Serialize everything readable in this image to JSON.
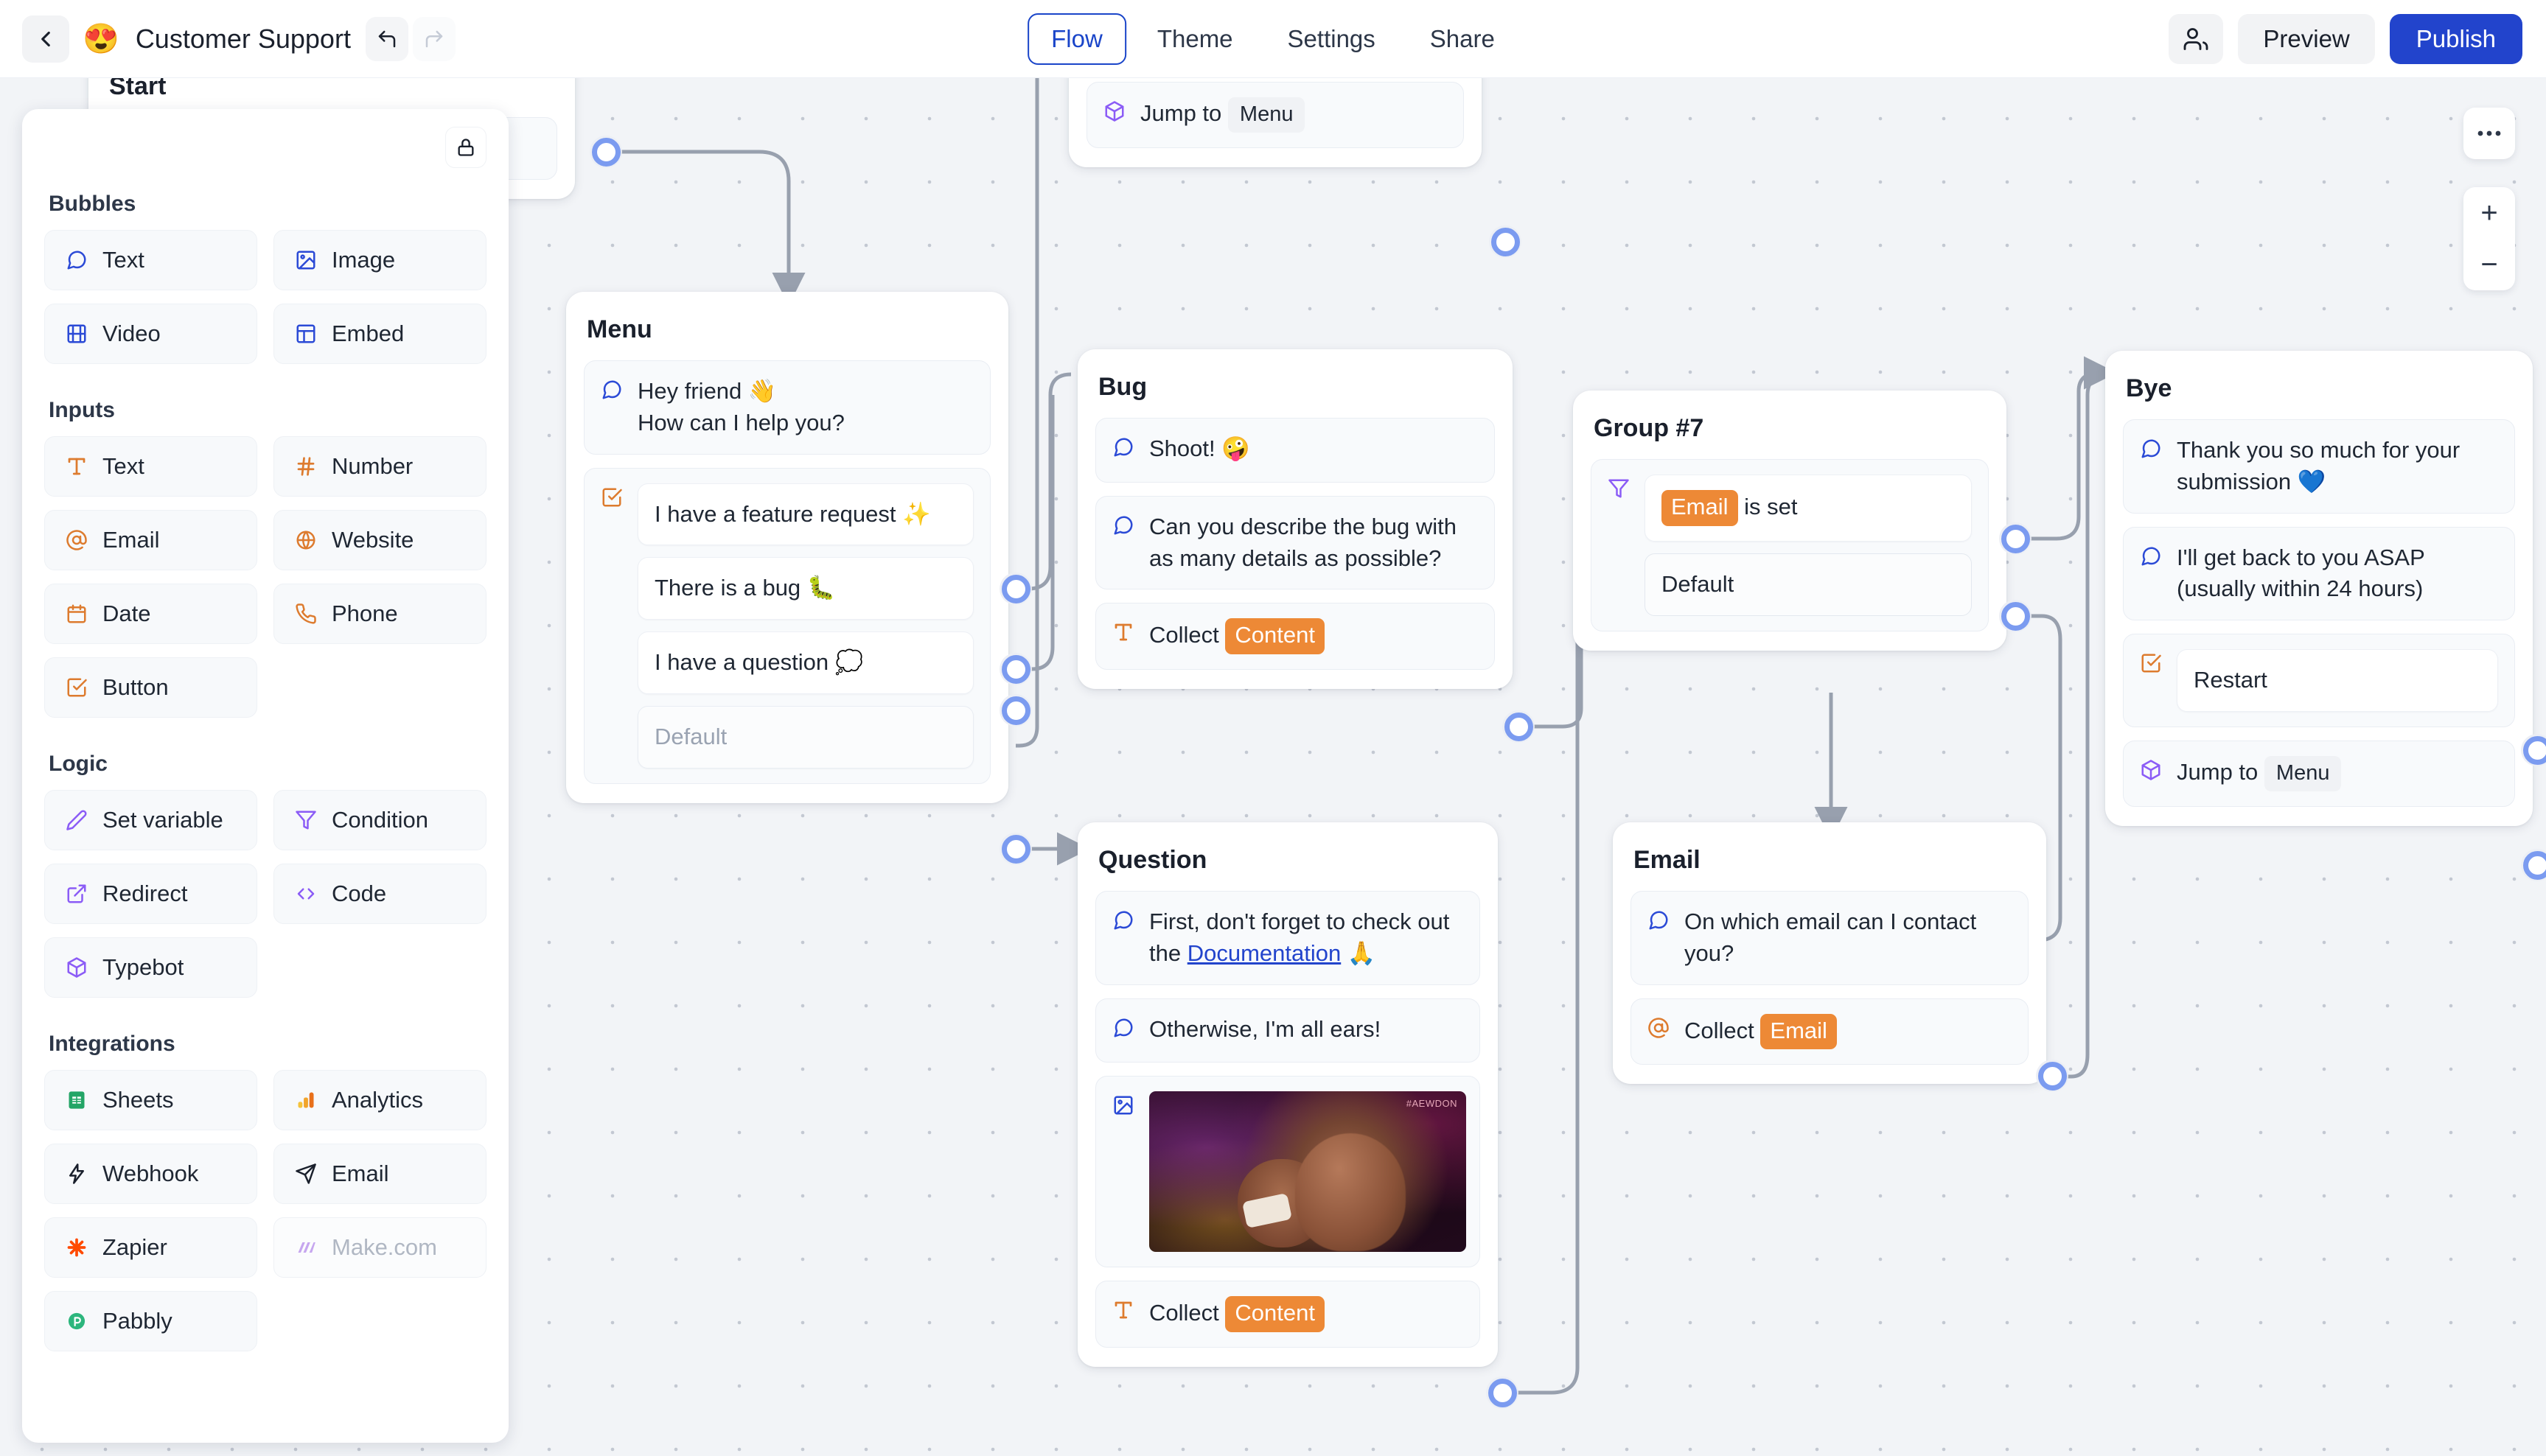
{
  "header": {
    "back_icon": "chevron-left-icon",
    "bot_emoji": "😍",
    "bot_title": "Customer Support",
    "undo_icon": "undo-icon",
    "redo_icon": "redo-icon",
    "tabs": [
      {
        "label": "Flow",
        "active": true
      },
      {
        "label": "Theme",
        "active": false
      },
      {
        "label": "Settings",
        "active": false
      },
      {
        "label": "Share",
        "active": false
      }
    ],
    "members_icon": "members-icon",
    "preview_label": "Preview",
    "publish_label": "Publish",
    "accent_color": "#2244cc"
  },
  "sidebar": {
    "lock_icon": "lock-icon",
    "sections": [
      {
        "title": "Bubbles",
        "items": [
          {
            "label": "Text",
            "icon": "chat-bubble-icon",
            "color": "#2b4ad6"
          },
          {
            "label": "Image",
            "icon": "image-icon",
            "color": "#2b4ad6"
          },
          {
            "label": "Video",
            "icon": "film-icon",
            "color": "#2b4ad6"
          },
          {
            "label": "Embed",
            "icon": "layout-icon",
            "color": "#2b4ad6"
          }
        ]
      },
      {
        "title": "Inputs",
        "items": [
          {
            "label": "Text",
            "icon": "text-type-icon",
            "color": "#dd7b2e"
          },
          {
            "label": "Number",
            "icon": "hash-icon",
            "color": "#dd7b2e"
          },
          {
            "label": "Email",
            "icon": "at-sign-icon",
            "color": "#dd7b2e"
          },
          {
            "label": "Website",
            "icon": "globe-icon",
            "color": "#dd7b2e"
          },
          {
            "label": "Date",
            "icon": "calendar-icon",
            "color": "#dd7b2e"
          },
          {
            "label": "Phone",
            "icon": "phone-icon",
            "color": "#dd7b2e"
          },
          {
            "label": "Button",
            "icon": "checkbox-icon",
            "color": "#dd7b2e"
          }
        ]
      },
      {
        "title": "Logic",
        "items": [
          {
            "label": "Set variable",
            "icon": "pencil-icon",
            "color": "#8b5cf6"
          },
          {
            "label": "Condition",
            "icon": "filter-icon",
            "color": "#8b5cf6"
          },
          {
            "label": "Redirect",
            "icon": "external-link-icon",
            "color": "#8b5cf6"
          },
          {
            "label": "Code",
            "icon": "code-icon",
            "color": "#8b5cf6"
          },
          {
            "label": "Typebot",
            "icon": "cube-icon",
            "color": "#8b5cf6"
          }
        ]
      },
      {
        "title": "Integrations",
        "items": [
          {
            "label": "Sheets",
            "icon": "google-sheets-icon",
            "color": "#23a566"
          },
          {
            "label": "Analytics",
            "icon": "google-analytics-icon",
            "color": "#e8a020"
          },
          {
            "label": "Webhook",
            "icon": "zap-icon",
            "color": "#1a202c"
          },
          {
            "label": "Email",
            "icon": "send-icon",
            "color": "#1a202c"
          },
          {
            "label": "Zapier",
            "icon": "zapier-icon",
            "color": "#ff4a00"
          },
          {
            "label": "Make.com",
            "icon": "make-icon",
            "color": "#c6a6ef",
            "disabled": true
          },
          {
            "label": "Pabbly",
            "icon": "pabbly-icon",
            "color": "#2cb67d"
          }
        ]
      }
    ]
  },
  "canvas": {
    "more_icon": "ellipsis-icon",
    "zoom_in_label": "+",
    "zoom_out_label": "−",
    "groups": [
      {
        "id": "start",
        "title": "Start",
        "blocks": []
      },
      {
        "id": "menu",
        "title": "Menu",
        "blocks": [
          {
            "type": "text-bubble",
            "icon": "chat-bubble-icon",
            "lines": [
              "Hey friend 👋",
              "How can I help you?"
            ]
          },
          {
            "type": "buttons-input",
            "icon": "checkbox-icon",
            "choices": [
              "I have a feature request ✨",
              "There is a bug 🐛",
              "I have a question 💭"
            ],
            "default_label": "Default"
          }
        ]
      },
      {
        "id": "jump-top",
        "title": "",
        "blocks": [
          {
            "type": "jump",
            "icon": "cube-icon",
            "label": "Jump to",
            "target": "Menu"
          }
        ]
      },
      {
        "id": "bug",
        "title": "Bug",
        "blocks": [
          {
            "type": "text-bubble",
            "icon": "chat-bubble-icon",
            "lines": [
              "Shoot! 🤪"
            ]
          },
          {
            "type": "text-bubble",
            "icon": "chat-bubble-icon",
            "lines": [
              "Can you describe the bug with as many details as possible?"
            ]
          },
          {
            "type": "collect",
            "icon": "text-type-icon",
            "label": "Collect",
            "variable": "Content"
          }
        ]
      },
      {
        "id": "question",
        "title": "Question",
        "blocks": [
          {
            "type": "text-bubble-link",
            "icon": "chat-bubble-icon",
            "prefix": "First, don't forget to check out the ",
            "link": "Documentation",
            "suffix": " 🙏"
          },
          {
            "type": "text-bubble",
            "icon": "chat-bubble-icon",
            "lines": [
              "Otherwise, I'm all ears!"
            ]
          },
          {
            "type": "image",
            "icon": "image-icon",
            "alt_tag": "#AEWDON"
          },
          {
            "type": "collect",
            "icon": "text-type-icon",
            "label": "Collect",
            "variable": "Content"
          }
        ]
      },
      {
        "id": "group7",
        "title": "Group #7",
        "blocks": [
          {
            "type": "condition",
            "icon": "filter-icon",
            "variable": "Email",
            "operator": "is set",
            "default_label": "Default"
          }
        ]
      },
      {
        "id": "email",
        "title": "Email",
        "blocks": [
          {
            "type": "text-bubble",
            "icon": "chat-bubble-icon",
            "lines": [
              "On which email can I contact you?"
            ]
          },
          {
            "type": "collect",
            "icon": "at-sign-icon",
            "label": "Collect",
            "variable": "Email"
          }
        ]
      },
      {
        "id": "bye",
        "title": "Bye",
        "blocks": [
          {
            "type": "text-bubble",
            "icon": "chat-bubble-icon",
            "lines": [
              "Thank you so much for your submission 💙"
            ]
          },
          {
            "type": "text-bubble",
            "icon": "chat-bubble-icon",
            "lines": [
              "I'll get back to you ASAP (usually within 24 hours)"
            ]
          },
          {
            "type": "buttons-input",
            "icon": "checkbox-icon",
            "choices": [
              "Restart"
            ]
          },
          {
            "type": "jump",
            "icon": "cube-icon",
            "label": "Jump to",
            "target": "Menu"
          }
        ]
      }
    ]
  }
}
